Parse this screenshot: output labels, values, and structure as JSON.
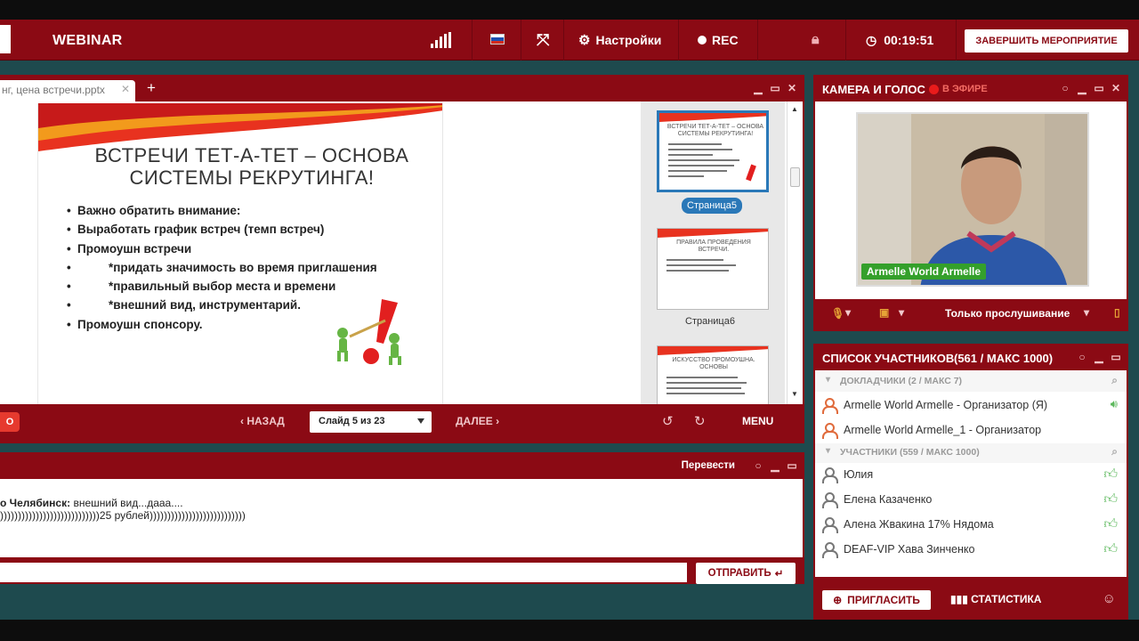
{
  "topbar": {
    "brand": "WEBINAR",
    "settings_label": "Настройки",
    "rec_label": "REC",
    "timer": "00:19:51",
    "end_button": "ЗАВЕРШИТЬ МЕРОПРИЯТИЕ",
    "colors": {
      "bar": "#8b0a14",
      "accent": "#2a78b8",
      "green": "#34a02b"
    }
  },
  "presentation": {
    "tab_name": "нг, цена встречи.pptx",
    "slide": {
      "title_line1": "ВСТРЕЧИ ТЕТ-А-ТЕТ – ОСНОВА",
      "title_line2": "СИСТЕМЫ РЕКРУТИНГА!",
      "bullets": [
        {
          "text": "Важно обратить внимание:",
          "indent": false
        },
        {
          "text": "Выработать график встреч (темп встреч)",
          "indent": false
        },
        {
          "text": "Промоушн встречи",
          "indent": false
        },
        {
          "text": "*придать значимость во время приглашения",
          "indent": true
        },
        {
          "text": "*правильный выбор места и времени",
          "indent": true
        },
        {
          "text": "*внешний вид, инструментарий.",
          "indent": true
        },
        {
          "text": "Промоушн спонсору.",
          "indent": false
        }
      ]
    },
    "thumbnails": [
      {
        "title": "ВСТРЕЧИ ТЕТ-А-ТЕТ – ОСНОВА СИСТЕМЫ РЕКРУТИНГА!",
        "label": "Страница5",
        "selected": true
      },
      {
        "title": "ПРАВИЛА ПРОВЕДЕНИЯ ВСТРЕЧИ.",
        "label": "Страница6",
        "selected": false
      },
      {
        "title": "ИСКУССТВО ПРОМОУШНА. ОСНОВЫ",
        "label": "",
        "selected": false
      }
    ],
    "footer": {
      "red_tab": "O",
      "back": "НАЗАД",
      "slide_select": "Слайд 5 из 23",
      "next": "ДАЛЕЕ",
      "menu": "MENU"
    }
  },
  "chat": {
    "translate_label": "Перевести",
    "messages": [
      {
        "author": "о Челябинск:",
        "text": "внешний вид...дааа...."
      },
      {
        "author": "",
        "text": "))))))))))))))))))))))))))))25 рублей)))))))))))))))))))))))))))"
      }
    ],
    "input_value": "",
    "send_label": "ОТПРАВИТЬ"
  },
  "camera": {
    "title": "КАМЕРА И ГОЛОС",
    "on_air": "В ЭФИРЕ",
    "presenter_name": "Armelle World Armelle",
    "mode": "Только прослушивание"
  },
  "participants": {
    "title": "СПИСОК УЧАСТНИКОВ",
    "count": "(561 / МАКС 1000)",
    "presenters_header": "ДОКЛАДЧИКИ (2 / МАКС 7)",
    "presenters": [
      {
        "name": "Armelle World Armelle - Организатор (Я)"
      },
      {
        "name": "Armelle World Armelle_1 - Организатор"
      }
    ],
    "attendees_header": "УЧАСТНИКИ (559 / МАКС 1000)",
    "attendees": [
      {
        "name": "Юлия"
      },
      {
        "name": "Елена Казаченко"
      },
      {
        "name": "Алена Жвакина 17% Нядома"
      },
      {
        "name": "DEAF-VIP Хава Зинченко"
      }
    ],
    "invite_label": "ПРИГЛАСИТЬ",
    "stats_label": "СТАТИСТИКА"
  }
}
